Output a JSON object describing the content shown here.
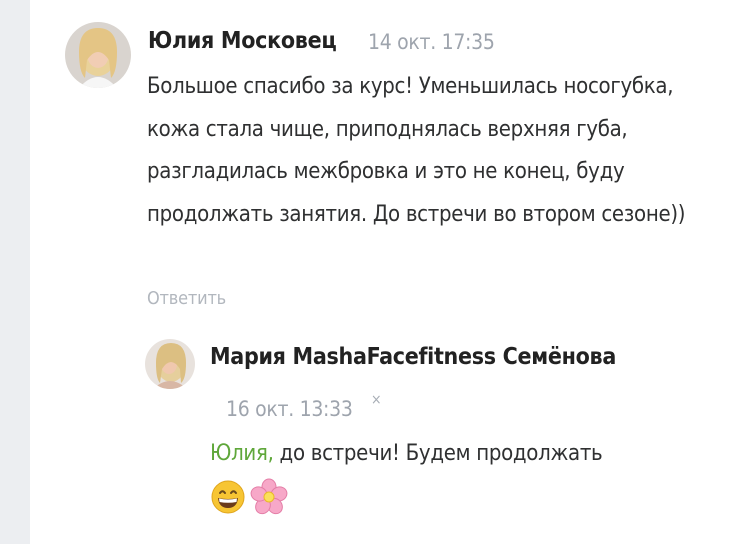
{
  "comment": {
    "author": "Юлия Московец",
    "date": "14 окт. 17:35",
    "text": "Большое спасибо за курс! Уменьшилась носогубка, кожа стала чище, приподнялась верхняя губа, разгладилась межбровка и это не конец, буду продолжать занятия. До встречи во втором сезоне))",
    "reply_label": "Ответить"
  },
  "reply": {
    "author": "Мария MashaFacefitness Семёнова",
    "date": "16 окт. 13:33",
    "close_glyph": "×",
    "mention": "Юлия,",
    "text": " до встречи! Будем продолжать",
    "emojis": [
      "grinning-face-icon",
      "cherry-blossom-icon"
    ]
  },
  "colors": {
    "mention": "#5fa73a",
    "muted": "#9ea4ad",
    "text": "#2f3031",
    "background": "#eceef1"
  }
}
